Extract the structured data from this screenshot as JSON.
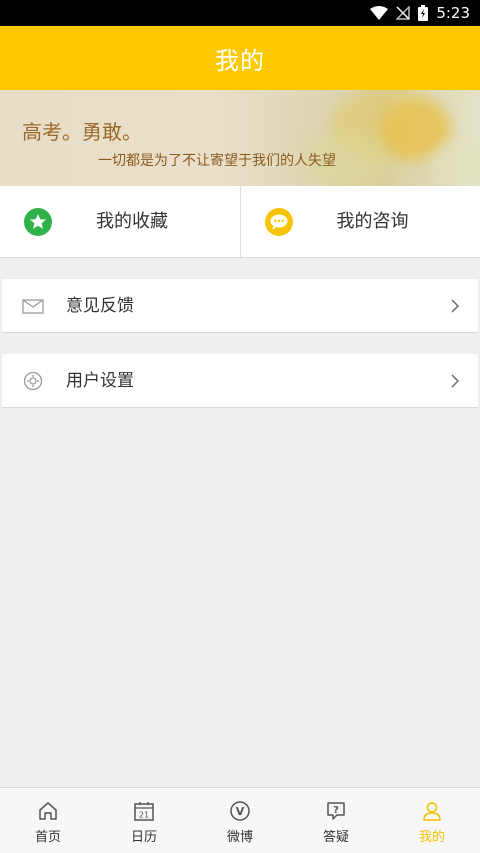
{
  "status_bar": {
    "time": "5:23"
  },
  "header": {
    "title": "我的"
  },
  "banner": {
    "headline": "高考。勇敢。",
    "subline": "一切都是为了不让寄望于我们的人失望"
  },
  "quick_actions": [
    {
      "label": "我的收藏",
      "icon": "star-icon",
      "color": "#2fb24a"
    },
    {
      "label": "我的咨询",
      "icon": "chat-icon",
      "color": "#f6c400"
    }
  ],
  "menu": [
    {
      "label": "意见反馈",
      "icon": "mail-icon"
    },
    {
      "label": "用户设置",
      "icon": "settings-icon"
    }
  ],
  "bottom_nav": [
    {
      "label": "首页",
      "icon": "home-icon"
    },
    {
      "label": "日历",
      "icon": "calendar-icon",
      "icon_text": "21"
    },
    {
      "label": "微博",
      "icon": "weibo-icon",
      "icon_text": "V"
    },
    {
      "label": "答疑",
      "icon": "question-icon",
      "icon_text": "?"
    },
    {
      "label": "我的",
      "icon": "profile-icon",
      "active": true
    }
  ],
  "colors": {
    "accent": "#fdca02",
    "nav_active": "#f5c000",
    "star_green": "#2fb24a",
    "chat_yellow": "#f6c400"
  }
}
